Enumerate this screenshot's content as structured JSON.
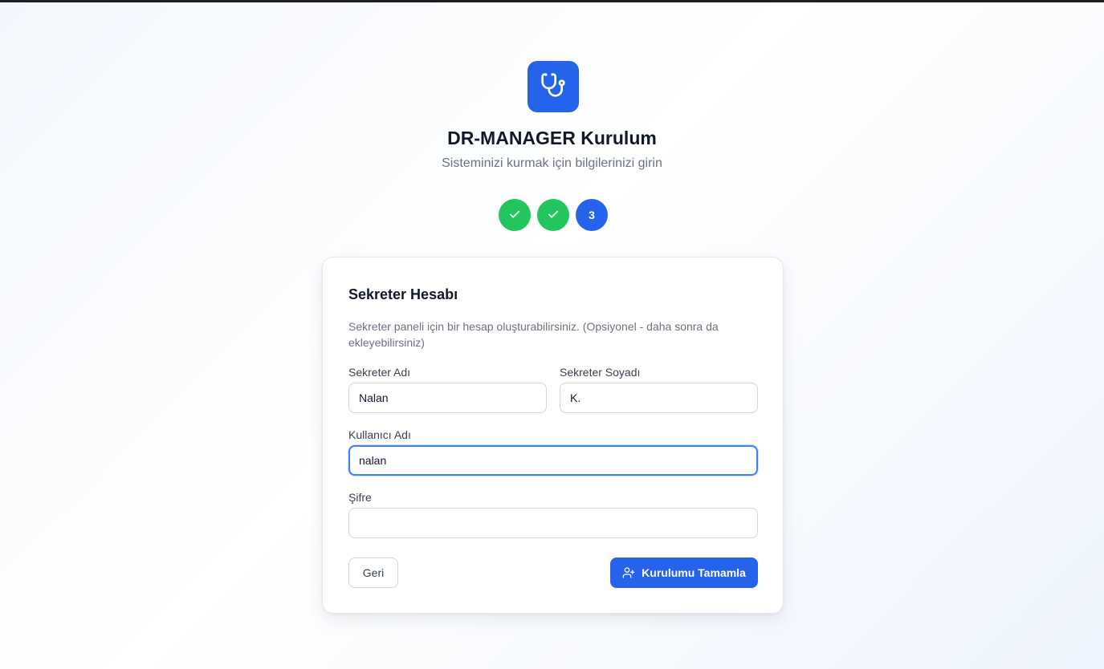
{
  "header": {
    "logo_icon": "stethoscope-icon",
    "title": "DR-MANAGER Kurulum",
    "subtitle": "Sisteminizi kurmak için bilgilerinizi girin"
  },
  "colors": {
    "brand": "#2563eb",
    "step_done": "#22c55e",
    "step_active": "#2563eb"
  },
  "steps": [
    {
      "status": "done",
      "icon": "check-icon"
    },
    {
      "status": "done",
      "icon": "check-icon"
    },
    {
      "status": "active",
      "label": "3"
    }
  ],
  "form": {
    "title": "Sekreter Hesabı",
    "description": "Sekreter paneli için bir hesap oluşturabilirsiniz. (Opsiyonel - daha sonra da ekleyebilirsiniz)",
    "first_name": {
      "label": "Sekreter Adı",
      "value": "Nalan"
    },
    "last_name": {
      "label": "Sekreter Soyadı",
      "value": "K."
    },
    "username": {
      "label": "Kullanıcı Adı",
      "value": "nalan"
    },
    "password": {
      "label": "Şifre",
      "value": ""
    },
    "back_label": "Geri",
    "submit_label": "Kurulumu Tamamla",
    "submit_icon": "user-plus-icon"
  }
}
